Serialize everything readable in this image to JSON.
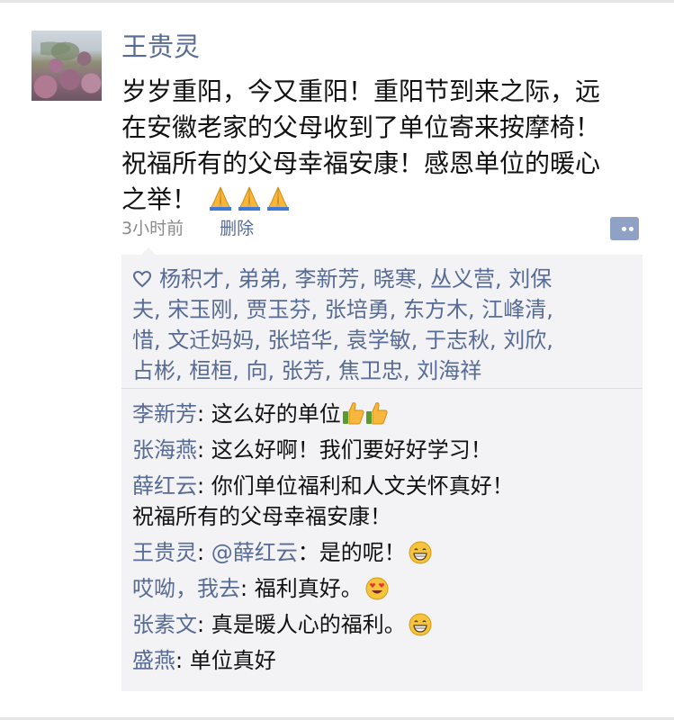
{
  "post": {
    "author": "王贵灵",
    "lines": [
      "岁岁重阳，今又重阳！重阳节到来之际，远",
      "在安徽老家的父母收到了单位寄来按摩椅！",
      "祝福所有的父母幸福安康！感恩单位的暖心",
      "之举！"
    ],
    "emoji_suffix": [
      "folded-hands",
      "folded-hands",
      "folded-hands"
    ],
    "time": "3小时前",
    "delete_label": "删除"
  },
  "likes": {
    "lines": [
      "杨积才, 弟弟, 李新芳, 晓寒, 丛义营, 刘保",
      "夫, 宋玉刚, 贾玉芬, 张培勇, 东方木, 江峰清,",
      "惜, 文迁妈妈, 张培华, 袁学敏, 于志秋, 刘欣,",
      "占彬, 桓桓, 向, 张芳, 焦卫忠, 刘海祥"
    ]
  },
  "comments": [
    {
      "name": "李新芳",
      "sep": ": ",
      "text": "这么好的单位",
      "emoji": "thumbs-up-x2"
    },
    {
      "name": "张海燕",
      "sep": ": ",
      "text": "这么好啊！我们要好好学习！"
    },
    {
      "name": "薛红云",
      "sep": ": ",
      "text": "你们单位福利和人文关怀真好！",
      "text2": "祝福所有的父母幸福安康！"
    },
    {
      "name": "王贵灵",
      "sep": ": ",
      "mention": "@薛红云",
      "text": "：是的呢！",
      "emoji": "grin"
    },
    {
      "name": "哎呦，我去",
      "sep": ": ",
      "text": "福利真好。",
      "emoji": "heart-eyes"
    },
    {
      "name": "张素文",
      "sep": ": ",
      "text": "真是暖人心的福利。",
      "emoji": "grin"
    },
    {
      "name": "盛燕",
      "sep": ": ",
      "text": "单位真好"
    }
  ],
  "colors": {
    "link": "#576b95",
    "panel": "#f3f3f5",
    "text": "#111111",
    "meta": "#8a8a8a"
  }
}
